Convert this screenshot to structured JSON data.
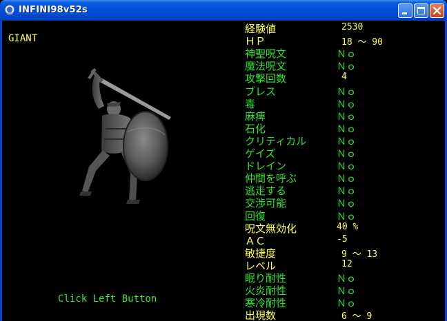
{
  "window": {
    "title": "INFINI98v52s"
  },
  "monster": {
    "name": "GIANT"
  },
  "hint": "Click Left Button",
  "stats": [
    {
      "label": "経験値",
      "value": "2530",
      "label_color": "yellow",
      "value_color": "yellow",
      "vx": 140
    },
    {
      "label": "ＨＰ",
      "value": "18 〜  90",
      "label_color": "yellow",
      "value_color": "yellow",
      "vx": 140
    },
    {
      "label": "神聖呪文",
      "value": "Ｎｏ",
      "label_color": "green",
      "value_color": "green",
      "vx": 133
    },
    {
      "label": "魔法呪文",
      "value": "Ｎｏ",
      "label_color": "green",
      "value_color": "green",
      "vx": 133
    },
    {
      "label": "攻撃回数",
      "value": "4",
      "label_color": "green",
      "value_color": "yellow",
      "vx": 140
    },
    {
      "label": "ブレス",
      "value": "Ｎｏ",
      "label_color": "green",
      "value_color": "green",
      "vx": 133
    },
    {
      "label": "毒",
      "value": "Ｎｏ",
      "label_color": "green",
      "value_color": "green",
      "vx": 133
    },
    {
      "label": "麻痺",
      "value": "Ｎｏ",
      "label_color": "green",
      "value_color": "green",
      "vx": 133
    },
    {
      "label": "石化",
      "value": "Ｎｏ",
      "label_color": "green",
      "value_color": "green",
      "vx": 133
    },
    {
      "label": "クリティカル",
      "value": "Ｎｏ",
      "label_color": "green",
      "value_color": "green",
      "vx": 133
    },
    {
      "label": "ゲイズ",
      "value": "Ｎｏ",
      "label_color": "green",
      "value_color": "green",
      "vx": 133
    },
    {
      "label": "ドレイン",
      "value": "Ｎｏ",
      "label_color": "green",
      "value_color": "green",
      "vx": 133
    },
    {
      "label": "仲間を呼ぶ",
      "value": "Ｎｏ",
      "label_color": "green",
      "value_color": "green",
      "vx": 133
    },
    {
      "label": "逃走する",
      "value": "Ｎｏ",
      "label_color": "green",
      "value_color": "green",
      "vx": 133
    },
    {
      "label": "交渉可能",
      "value": "Ｎｏ",
      "label_color": "green",
      "value_color": "green",
      "vx": 133
    },
    {
      "label": "回復",
      "value": "Ｎｏ",
      "label_color": "green",
      "value_color": "green",
      "vx": 133
    },
    {
      "label": "呪文無効化",
      "value": "40 %",
      "label_color": "yellow",
      "value_color": "yellow",
      "vx": 133
    },
    {
      "label": "ＡＣ",
      "value": "-5",
      "label_color": "yellow",
      "value_color": "yellow",
      "vx": 133
    },
    {
      "label": "敏捷度",
      "value": "9 〜  13",
      "label_color": "yellow",
      "value_color": "yellow",
      "vx": 140
    },
    {
      "label": "レベル",
      "value": "12",
      "label_color": "yellow",
      "value_color": "yellow",
      "vx": 140
    },
    {
      "label": "眠り耐性",
      "value": "Ｎｏ",
      "label_color": "green",
      "value_color": "green",
      "vx": 133
    },
    {
      "label": "火炎耐性",
      "value": "Ｎｏ",
      "label_color": "green",
      "value_color": "green",
      "vx": 133
    },
    {
      "label": "寒冷耐性",
      "value": "Ｎｏ",
      "label_color": "green",
      "value_color": "green",
      "vx": 133
    },
    {
      "label": "出現数",
      "value": "6 〜  9",
      "label_color": "yellow",
      "value_color": "yellow",
      "vx": 140
    }
  ]
}
